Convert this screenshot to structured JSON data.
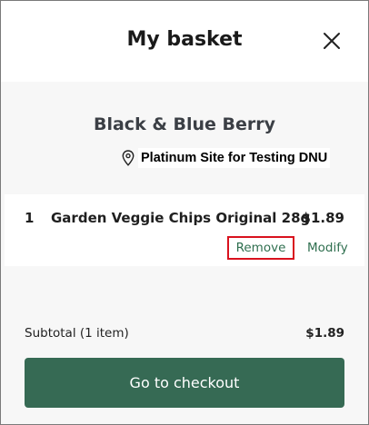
{
  "header": {
    "title": "My basket",
    "close_icon": "close-icon"
  },
  "store": {
    "name": "Black & Blue Berry",
    "location_icon": "location-pin-icon",
    "location": "Platinum Site for Testing DNU"
  },
  "items": [
    {
      "qty": "1",
      "name": "Garden Veggie Chips Original 28g",
      "price": "$1.89",
      "remove_label": "Remove",
      "modify_label": "Modify"
    }
  ],
  "footer": {
    "subtotal_label": "Subtotal (1 item)",
    "subtotal_value": "$1.89",
    "checkout_label": "Go to checkout"
  },
  "colors": {
    "accent": "#366a54",
    "link": "#2f6f4f",
    "highlight_border": "#d9121e",
    "panel_bg": "#f7f7f7"
  }
}
